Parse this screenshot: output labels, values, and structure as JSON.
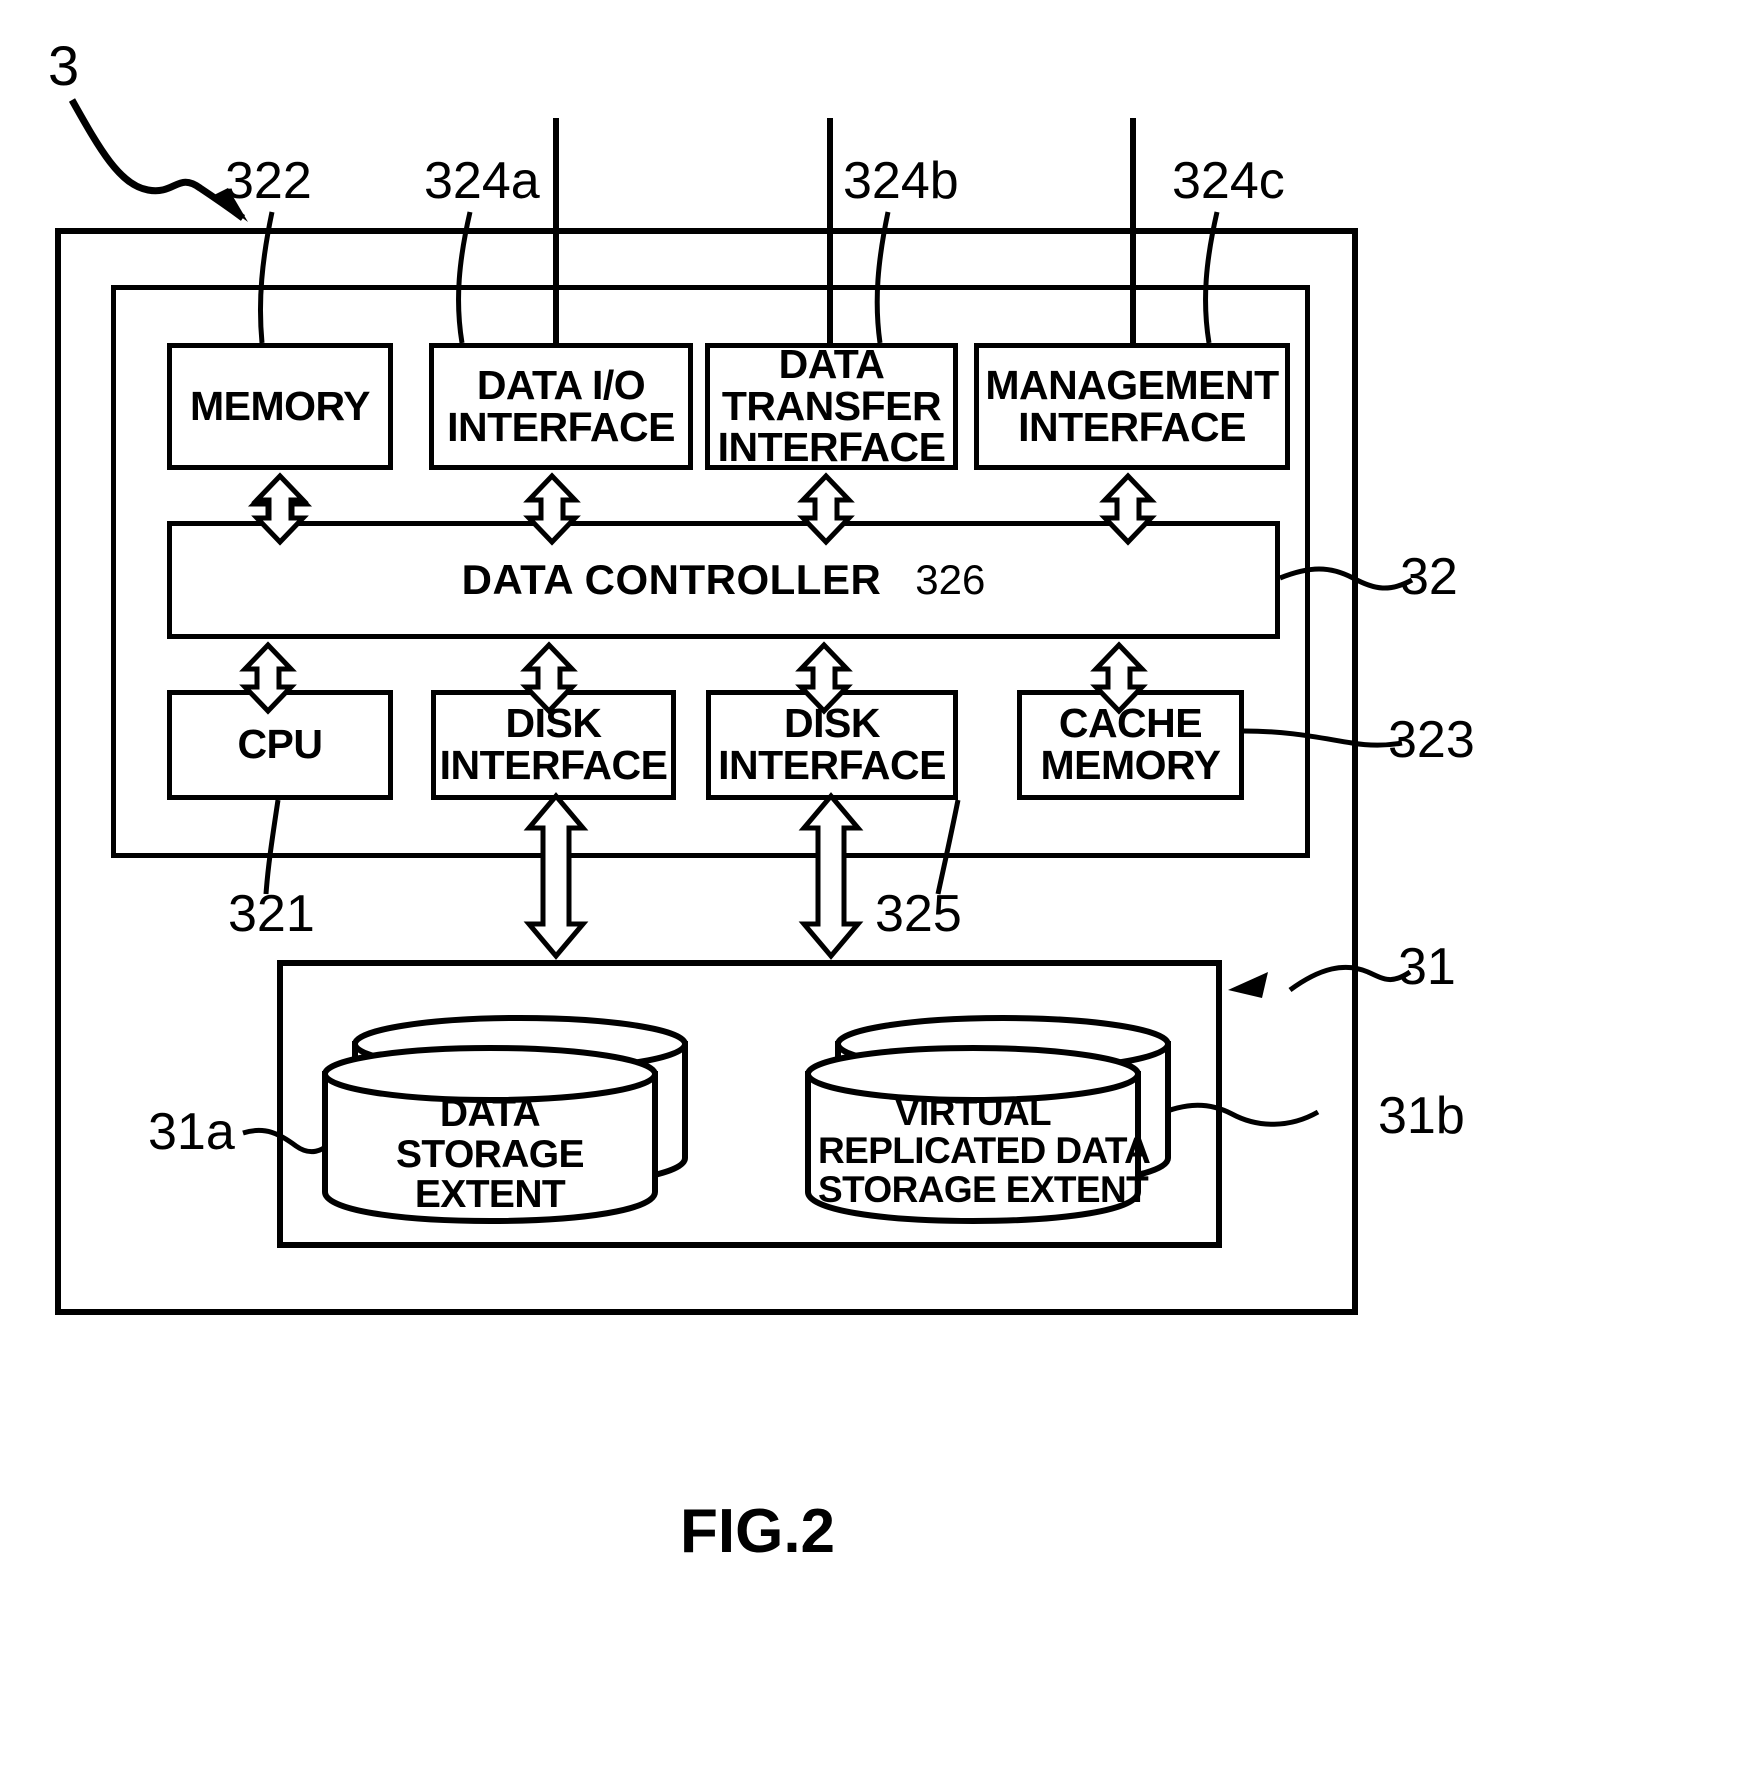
{
  "figure": {
    "caption": "FIG.2",
    "system_ref": "3"
  },
  "callouts": {
    "memory_ref": "322",
    "data_io_ref": "324a",
    "data_transfer_ref": "324b",
    "management_ref": "324c",
    "controller_unit_ref": "32",
    "lower_row_ref": "323",
    "cpu_ref": "321",
    "disk_if_ref": "325",
    "storage_unit_ref": "31",
    "storage_extent_ref": "31a",
    "virtual_extent_ref": "31b"
  },
  "top_row": [
    {
      "id": "memory",
      "lines": [
        "MEMORY"
      ]
    },
    {
      "id": "data-io-interface",
      "lines": [
        "DATA I/O",
        "INTERFACE"
      ]
    },
    {
      "id": "data-transfer-interface",
      "lines": [
        "DATA",
        "TRANSFER",
        "INTERFACE"
      ]
    },
    {
      "id": "management-interface",
      "lines": [
        "MANAGEMENT",
        "INTERFACE"
      ]
    }
  ],
  "controller": {
    "label": "DATA CONTROLLER",
    "number": "326"
  },
  "bottom_row": [
    {
      "id": "cpu",
      "lines": [
        "CPU"
      ]
    },
    {
      "id": "disk-interface-1",
      "lines": [
        "DISK",
        "INTERFACE"
      ]
    },
    {
      "id": "disk-interface-2",
      "lines": [
        "DISK",
        "INTERFACE"
      ]
    },
    {
      "id": "cache-memory",
      "lines": [
        "CACHE",
        "MEMORY"
      ]
    }
  ],
  "storage": [
    {
      "id": "data-storage-extent",
      "lines": [
        "DATA",
        "STORAGE",
        "EXTENT"
      ]
    },
    {
      "id": "virtual-replicated-data-storage-extent",
      "lines": [
        "VIRTUAL",
        "REPLICATED DATA",
        "STORAGE EXTENT"
      ]
    }
  ],
  "colors": {
    "ink": "#000000",
    "paper": "#ffffff"
  }
}
